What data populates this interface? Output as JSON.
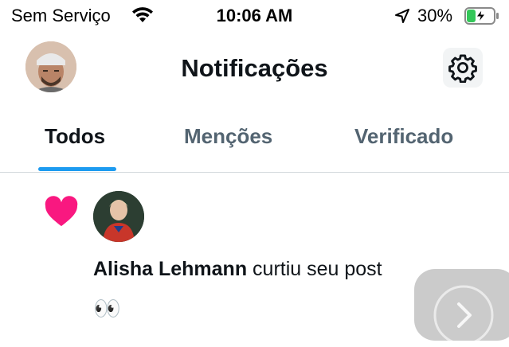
{
  "status_bar": {
    "carrier": "Sem Serviço",
    "time": "10:06 AM",
    "battery_percent": "30%",
    "battery_level": 0.3,
    "icons": [
      "wifi-icon",
      "location-arrow-icon",
      "battery-charging-icon"
    ]
  },
  "header": {
    "title": "Notificações",
    "settings_icon": "gear-icon"
  },
  "tabs": [
    {
      "label": "Todos",
      "active": true
    },
    {
      "label": "Menções",
      "active": false
    },
    {
      "label": "Verificado",
      "active": false
    }
  ],
  "notification": {
    "icon": "heart-icon",
    "user_name": "Alisha Lehmann",
    "action_text": " curtiu seu post",
    "post_preview": "👀"
  },
  "colors": {
    "accent": "#1d9bf0",
    "heart": "#f91880",
    "text_primary": "#0f1419",
    "text_secondary": "#536471"
  }
}
